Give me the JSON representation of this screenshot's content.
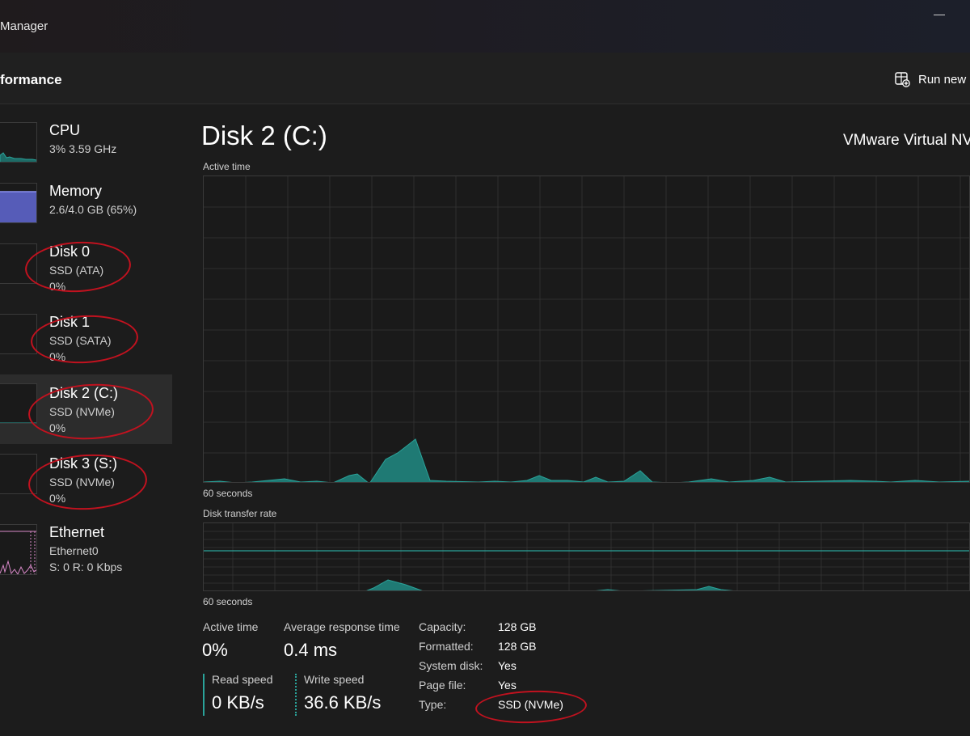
{
  "window": {
    "title": "Manager"
  },
  "header": {
    "heading": "formance",
    "run_task_label": "Run new"
  },
  "colors": {
    "accent": "#2aa39a",
    "memory": "#6b72d6",
    "ethernet": "#d889c8",
    "annotation_ring": "#c1121f"
  },
  "sidebar": {
    "items": [
      {
        "name": "CPU",
        "sub1": "3%  3.59 GHz",
        "sub2": ""
      },
      {
        "name": "Memory",
        "sub1": "2.6/4.0 GB (65%)",
        "sub2": ""
      },
      {
        "name": "Disk 0",
        "sub1": "SSD (ATA)",
        "sub2": "0%"
      },
      {
        "name": "Disk 1",
        "sub1": "SSD (SATA)",
        "sub2": "0%"
      },
      {
        "name": "Disk 2 (C:)",
        "sub1": "SSD (NVMe)",
        "sub2": "0%"
      },
      {
        "name": "Disk 3 (S:)",
        "sub1": "SSD (NVMe)",
        "sub2": "0%"
      },
      {
        "name": "Ethernet",
        "sub1": "Ethernet0",
        "sub2": "S: 0  R: 0 Kbps"
      }
    ],
    "selected_index": 4
  },
  "main": {
    "title": "Disk 2 (C:)",
    "model": "VMware Virtual NV",
    "active_time_graph_label": "Active time",
    "active_time_axis_label": "60 seconds",
    "transfer_graph_label": "Disk transfer rate",
    "transfer_axis_label": "60 seconds",
    "stats": {
      "active_time_label": "Active time",
      "active_time_value": "0%",
      "avg_response_label": "Average response time",
      "avg_response_value": "0.4 ms",
      "read_speed_label": "Read speed",
      "read_speed_value": "0 KB/s",
      "write_speed_label": "Write speed",
      "write_speed_value": "36.6 KB/s"
    },
    "properties": [
      {
        "label": "Capacity:",
        "value": "128 GB"
      },
      {
        "label": "Formatted:",
        "value": "128 GB"
      },
      {
        "label": "System disk:",
        "value": "Yes"
      },
      {
        "label": "Page file:",
        "value": "Yes"
      },
      {
        "label": "Type:",
        "value": "SSD (NVMe)"
      }
    ]
  }
}
